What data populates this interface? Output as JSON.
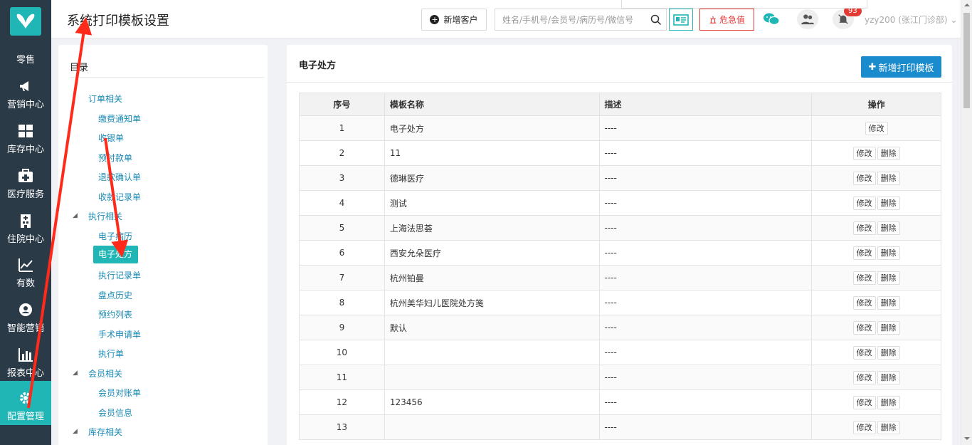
{
  "sidebar": {
    "items": [
      {
        "label": "零售",
        "icon": "retail-icon"
      },
      {
        "label": "营销中心",
        "icon": "megaphone-icon"
      },
      {
        "label": "库存中心",
        "icon": "grid-icon"
      },
      {
        "label": "医疗服务",
        "icon": "medkit-icon"
      },
      {
        "label": "住院中心",
        "icon": "hospital-icon"
      },
      {
        "label": "有数",
        "icon": "trend-icon"
      },
      {
        "label": "智能营销",
        "icon": "smart-icon"
      },
      {
        "label": "报表中心",
        "icon": "bar-chart-icon"
      },
      {
        "label": "配置管理",
        "icon": "gear-icon"
      }
    ],
    "active_color": "#1fb6b5"
  },
  "header": {
    "title": "系统打印模板设置",
    "new_customer": "新增客户",
    "search_placeholder": "姓名/手机号/会员号/病历号/微信号",
    "danger_label": "危急值",
    "badge_count": "93",
    "user": "yzy200 (张江门诊部) ⌄"
  },
  "directory": {
    "title": "目录",
    "groups": {
      "order": "订单相关",
      "exec": "执行相关",
      "member": "会员相关",
      "stock": "库存相关"
    },
    "order_items": [
      "缴费通知单",
      "收银单",
      "预付款单",
      "退款确认单",
      "收款记录单"
    ],
    "exec_items": [
      "电子病历",
      "电子处方",
      "执行记录单",
      "盘点历史",
      "预约列表",
      "手术申请单",
      "执行单"
    ],
    "member_items": [
      "会员对账单",
      "会员信息"
    ]
  },
  "main": {
    "title": "电子处方",
    "add_button": "新增打印模板",
    "columns": [
      "序号",
      "模板名称",
      "描述",
      "操作"
    ],
    "edit_label": "修改",
    "delete_label": "删除",
    "rows": [
      {
        "idx": "1",
        "name": "电子处方",
        "desc": "----",
        "deletable": false
      },
      {
        "idx": "2",
        "name": "11",
        "desc": "----",
        "deletable": true
      },
      {
        "idx": "3",
        "name": "德琳医疗",
        "desc": "----",
        "deletable": true
      },
      {
        "idx": "4",
        "name": "测试",
        "desc": "----",
        "deletable": true
      },
      {
        "idx": "5",
        "name": "上海法思荟",
        "desc": "----",
        "deletable": true
      },
      {
        "idx": "6",
        "name": "西安允朵医疗",
        "desc": "----",
        "deletable": true
      },
      {
        "idx": "7",
        "name": "杭州铂曼",
        "desc": "----",
        "deletable": true
      },
      {
        "idx": "8",
        "name": "杭州美华妇儿医院处方笺",
        "desc": "----",
        "deletable": true
      },
      {
        "idx": "9",
        "name": "默认",
        "desc": "----",
        "deletable": true
      },
      {
        "idx": "10",
        "name": "",
        "desc": "----",
        "deletable": true
      },
      {
        "idx": "11",
        "name": "",
        "desc": "----",
        "deletable": true
      },
      {
        "idx": "12",
        "name": "123456",
        "desc": "----",
        "deletable": true
      },
      {
        "idx": "13",
        "name": "",
        "desc": "----",
        "deletable": true
      }
    ]
  },
  "colors": {
    "teal": "#1fb6b5",
    "sidebar_bg": "#2b3a47",
    "primary_blue": "#1a8bcd",
    "danger_red": "#e53935",
    "annotation_red": "#ff2a1a"
  }
}
